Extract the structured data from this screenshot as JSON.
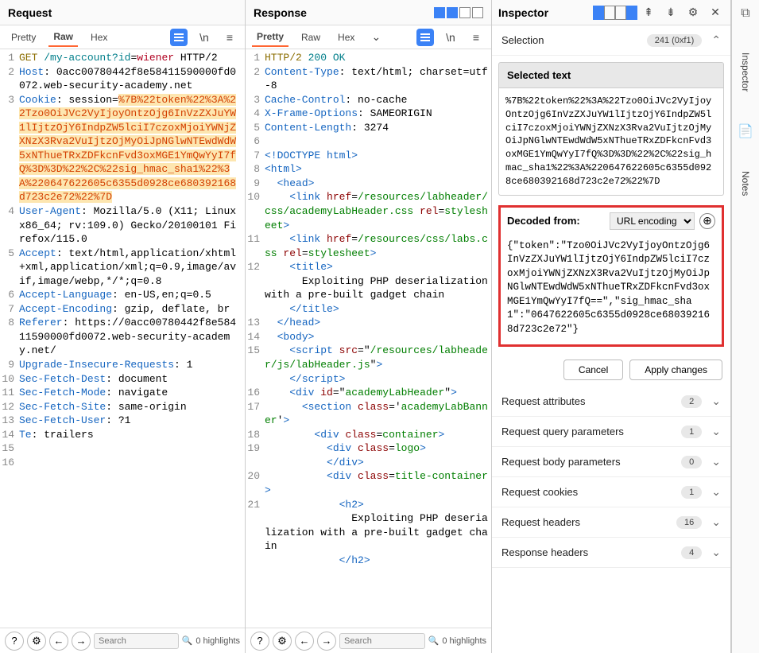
{
  "request": {
    "title": "Request",
    "tabs": {
      "pretty": "Pretty",
      "raw": "Raw",
      "hex": "Hex"
    },
    "lines": [
      {
        "n": "1",
        "html": "<span class='hl-method'>GET</span> <span class='hl-path'>/my-account</span><span class='hl-param'>?id</span>=<span class='hl-val'>wiener</span> HTTP/2"
      },
      {
        "n": "2",
        "html": "<span class='hl-header'>Host</span>: 0acc00780442f8e58411590000fd0072.web-security-academy.net"
      },
      {
        "n": "3",
        "html": "<span class='hl-header'>Cookie</span>: session=<span class='selected-text'>%7B%22token%22%3A%22Tzo0OiJVc2VyIjoyOntzOjg6InVzZXJuYW1lIjtzOjY6IndpZW5lciI7czoxMjoiYWNjZXNzX3Rva2VuIjtzOjMyOiJpNGlwNTEwdWdW5xNThueTRxZDFkcnFvd3oxMGE1YmQwYyI7fQ%3D%3D%22%2C%22sig_hmac_sha1%22%3A%220647622605c6355d0928ce680392168d723c2e72%22%7D</span>"
      },
      {
        "n": "4",
        "html": "<span class='hl-header'>User-Agent</span>: Mozilla/5.0 (X11; Linux x86_64; rv:109.0) Gecko/20100101 Firefox/115.0"
      },
      {
        "n": "5",
        "html": "<span class='hl-header'>Accept</span>: text/html,application/xhtml+xml,application/xml;q=0.9,image/avif,image/webp,*/*;q=0.8"
      },
      {
        "n": "6",
        "html": "<span class='hl-header'>Accept-Language</span>: en-US,en;q=0.5"
      },
      {
        "n": "7",
        "html": "<span class='hl-header'>Accept-Encoding</span>: gzip, deflate, br"
      },
      {
        "n": "8",
        "html": "<span class='hl-header'>Referer</span>: https://0acc00780442f8e58411590000fd0072.web-security-academy.net/"
      },
      {
        "n": "9",
        "html": "<span class='hl-header'>Upgrade-Insecure-Requests</span>: 1"
      },
      {
        "n": "10",
        "html": "<span class='hl-header'>Sec-Fetch-Dest</span>: document"
      },
      {
        "n": "11",
        "html": "<span class='hl-header'>Sec-Fetch-Mode</span>: navigate"
      },
      {
        "n": "12",
        "html": "<span class='hl-header'>Sec-Fetch-Site</span>: same-origin"
      },
      {
        "n": "13",
        "html": "<span class='hl-header'>Sec-Fetch-User</span>: ?1"
      },
      {
        "n": "14",
        "html": "<span class='hl-header'>Te</span>: trailers"
      },
      {
        "n": "15",
        "html": ""
      },
      {
        "n": "16",
        "html": ""
      }
    ],
    "search_placeholder": "Search",
    "highlights": "0 highlights"
  },
  "response": {
    "title": "Response",
    "tabs": {
      "pretty": "Pretty",
      "raw": "Raw",
      "hex": "Hex"
    },
    "lines": [
      {
        "n": "1",
        "html": "<span class='hl-method'>HTTP/2</span> <span class='hl-path'>200 OK</span>"
      },
      {
        "n": "2",
        "html": "<span class='hl-header'>Content-Type</span>: text/html; charset=utf-8"
      },
      {
        "n": "3",
        "html": "<span class='hl-header'>Cache-Control</span>: no-cache"
      },
      {
        "n": "4",
        "html": "<span class='hl-header'>X-Frame-Options</span>: SAMEORIGIN"
      },
      {
        "n": "5",
        "html": "<span class='hl-header'>Content-Length</span>: 3274"
      },
      {
        "n": "6",
        "html": ""
      },
      {
        "n": "7",
        "html": "<span class='hl-tag'>&lt;!DOCTYPE html&gt;</span>"
      },
      {
        "n": "8",
        "html": "<span class='hl-tag'>&lt;html&gt;</span>"
      },
      {
        "n": "9",
        "html": "  <span class='hl-tag'>&lt;head&gt;</span>"
      },
      {
        "n": "10",
        "html": "    <span class='hl-tag'>&lt;link</span> <span class='hl-attr'>href</span>=<span class='hl-str'>/resources/labheader/css/academyLabHeader.css</span> <span class='hl-attr'>rel</span>=<span class='hl-str'>stylesheet</span><span class='hl-tag'>&gt;</span>"
      },
      {
        "n": "11",
        "html": "    <span class='hl-tag'>&lt;link</span> <span class='hl-attr'>href</span>=<span class='hl-str'>/resources/css/labs.css</span> <span class='hl-attr'>rel</span>=<span class='hl-str'>stylesheet</span><span class='hl-tag'>&gt;</span>"
      },
      {
        "n": "12",
        "html": "    <span class='hl-tag'>&lt;title&gt;</span>\n      Exploiting PHP deserialization with a pre-built gadget chain\n    <span class='hl-tag'>&lt;/title&gt;</span>"
      },
      {
        "n": "13",
        "html": "  <span class='hl-tag'>&lt;/head&gt;</span>"
      },
      {
        "n": "14",
        "html": "  <span class='hl-tag'>&lt;body&gt;</span>"
      },
      {
        "n": "15",
        "html": "    <span class='hl-tag'>&lt;script</span> <span class='hl-attr'>src</span>=\"<span class='hl-str'>/resources/labheader/js/labHeader.js</span>\"<span class='hl-tag'>&gt;</span>\n    <span class='hl-tag'>&lt;/script&gt;</span>"
      },
      {
        "n": "16",
        "html": "    <span class='hl-tag'>&lt;div</span> <span class='hl-attr'>id</span>=\"<span class='hl-str'>academyLabHeader</span>\"<span class='hl-tag'>&gt;</span>"
      },
      {
        "n": "17",
        "html": "      <span class='hl-tag'>&lt;section</span> <span class='hl-attr'>class</span>='<span class='hl-str'>academyLabBanner</span>'<span class='hl-tag'>&gt;</span>"
      },
      {
        "n": "18",
        "html": "        <span class='hl-tag'>&lt;div</span> <span class='hl-attr'>class</span>=<span class='hl-str'>container</span><span class='hl-tag'>&gt;</span>"
      },
      {
        "n": "19",
        "html": "          <span class='hl-tag'>&lt;div</span> <span class='hl-attr'>class</span>=<span class='hl-str'>logo</span><span class='hl-tag'>&gt;</span>\n          <span class='hl-tag'>&lt;/div&gt;</span>"
      },
      {
        "n": "20",
        "html": "          <span class='hl-tag'>&lt;div</span> <span class='hl-attr'>class</span>=<span class='hl-str'>title-container</span><span class='hl-tag'>&gt;</span>"
      },
      {
        "n": "21",
        "html": "            <span class='hl-tag'>&lt;h2&gt;</span>\n              Exploiting PHP deserialization with a pre-built gadget chain\n            <span class='hl-tag'>&lt;/h2&gt;</span>"
      }
    ],
    "search_placeholder": "Search",
    "highlights": "0 highlights"
  },
  "inspector": {
    "title": "Inspector",
    "selection_label": "Selection",
    "selection_value": "241 (0xf1)",
    "selected_text_label": "Selected text",
    "selected_text": "%7B%22token%22%3A%22Tzo0OiJVc2VyIjoyOntzOjg6InVzZXJuYW1lIjtzOjY6IndpZW5lciI7czoxMjoiYWNjZXNzX3Rva2VuIjtzOjMyOiJpNGlwNTEwdWdW5xNThueTRxZDFkcnFvd3oxMGE1YmQwYyI7fQ%3D%3D%22%2C%22sig_hmac_sha1%22%3A%220647622605c6355d0928ce680392168d723c2e72%22%7D",
    "decoded_label": "Decoded from:",
    "decoded_encoding": "URL encoding",
    "decoded_text": "{\"token\":\"Tzo0OiJVc2VyIjoyOntzOjg6InVzZXJuYW1lIjtzOjY6IndpZW5lciI7czoxMjoiYWNjZXNzX3Rva2VuIjtzOjMyOiJpNGlwNTEwdWdW5xNThueTRxZDFkcnFvd3oxMGE1YmQwYyI7fQ==\",\"sig_hmac_sha1\":\"0647622605c6355d0928ce680392168d723c2e72\"}",
    "cancel": "Cancel",
    "apply": "Apply changes",
    "rows": [
      {
        "label": "Request attributes",
        "count": "2"
      },
      {
        "label": "Request query parameters",
        "count": "1"
      },
      {
        "label": "Request body parameters",
        "count": "0"
      },
      {
        "label": "Request cookies",
        "count": "1"
      },
      {
        "label": "Request headers",
        "count": "16"
      },
      {
        "label": "Response headers",
        "count": "4"
      }
    ]
  },
  "sidebar": {
    "inspector": "Inspector",
    "notes": "Notes"
  }
}
